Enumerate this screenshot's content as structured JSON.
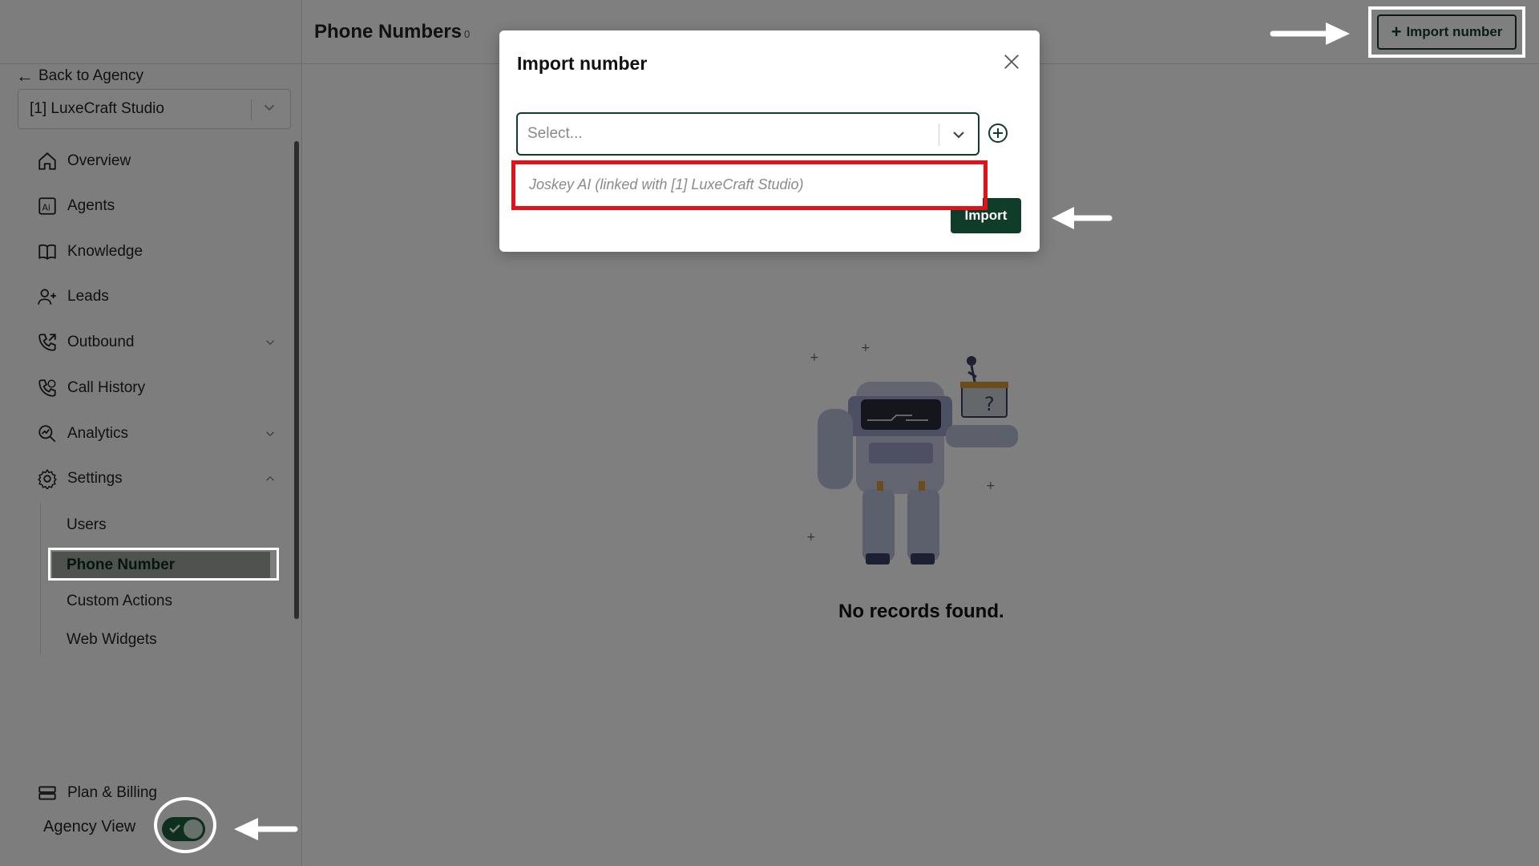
{
  "header": {
    "title": "Phone Numbers",
    "count": "0",
    "import_button": "Import number"
  },
  "sidebar": {
    "back_label": "Back to Agency",
    "org_select_value": "[1] LuxeCraft Studio",
    "nav": [
      {
        "label": "Overview",
        "icon": "home-icon"
      },
      {
        "label": "Agents",
        "icon": "ai-agent-icon"
      },
      {
        "label": "Knowledge",
        "icon": "book-icon"
      },
      {
        "label": "Leads",
        "icon": "user-plus-icon"
      },
      {
        "label": "Outbound",
        "icon": "phone-outgoing-icon"
      },
      {
        "label": "Call History",
        "icon": "phone-history-icon"
      },
      {
        "label": "Analytics",
        "icon": "analytics-icon"
      },
      {
        "label": "Settings",
        "icon": "gear-icon"
      }
    ],
    "settings_sub": [
      "Users",
      "Phone Number",
      "Custom Actions",
      "Web Widgets"
    ],
    "plan_billing": "Plan & Billing",
    "agency_view_label": "Agency View",
    "agency_view_on": true
  },
  "main": {
    "empty_text": "No records found."
  },
  "modal": {
    "title": "Import number",
    "select_placeholder": "Select...",
    "option": "Joskey AI (linked with [1] LuxeCraft Studio)",
    "import_button": "Import"
  },
  "colors": {
    "brand": "#0f3d2a",
    "highlight": "#e0131a",
    "annotation": "#ffffff"
  }
}
